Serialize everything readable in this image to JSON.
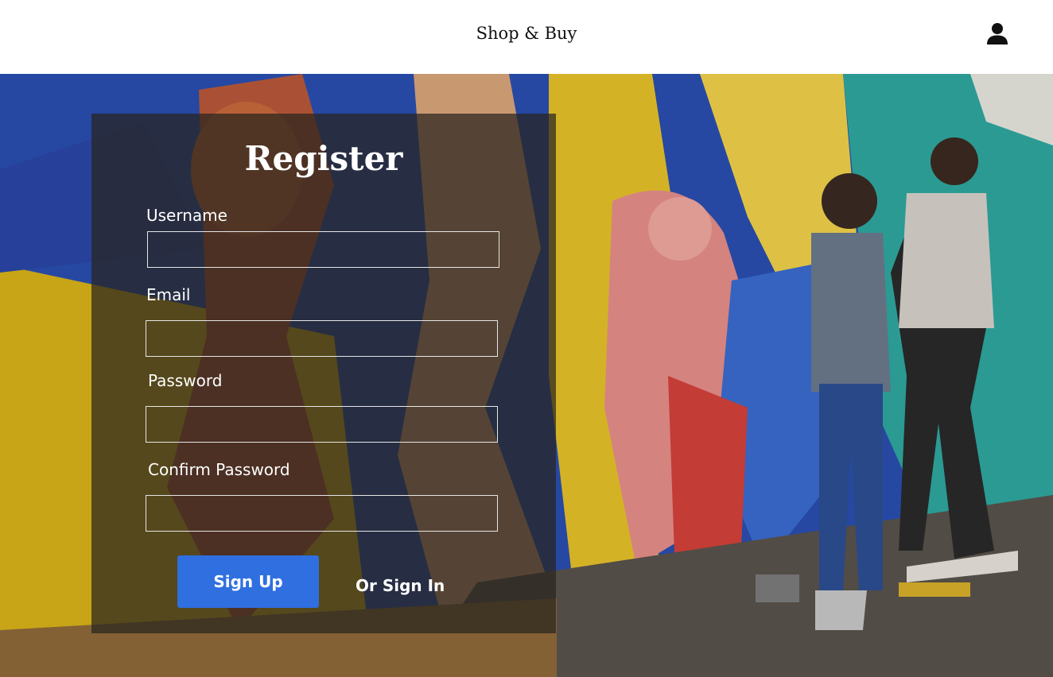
{
  "header": {
    "brand": "Shop & Buy",
    "account_icon": "user-icon"
  },
  "hero": {
    "image": "mural-painting-photo"
  },
  "register": {
    "title": "Register",
    "fields": [
      {
        "label": "Username",
        "value": ""
      },
      {
        "label": "Email",
        "value": ""
      },
      {
        "label": "Password",
        "value": ""
      },
      {
        "label": "Confirm Password",
        "value": ""
      }
    ],
    "signup_label": "Sign Up",
    "signin_label": "Or Sign In"
  },
  "colors": {
    "button": "#2f6fe0",
    "panel_overlay": "rgba(40,36,30,0.72)"
  }
}
